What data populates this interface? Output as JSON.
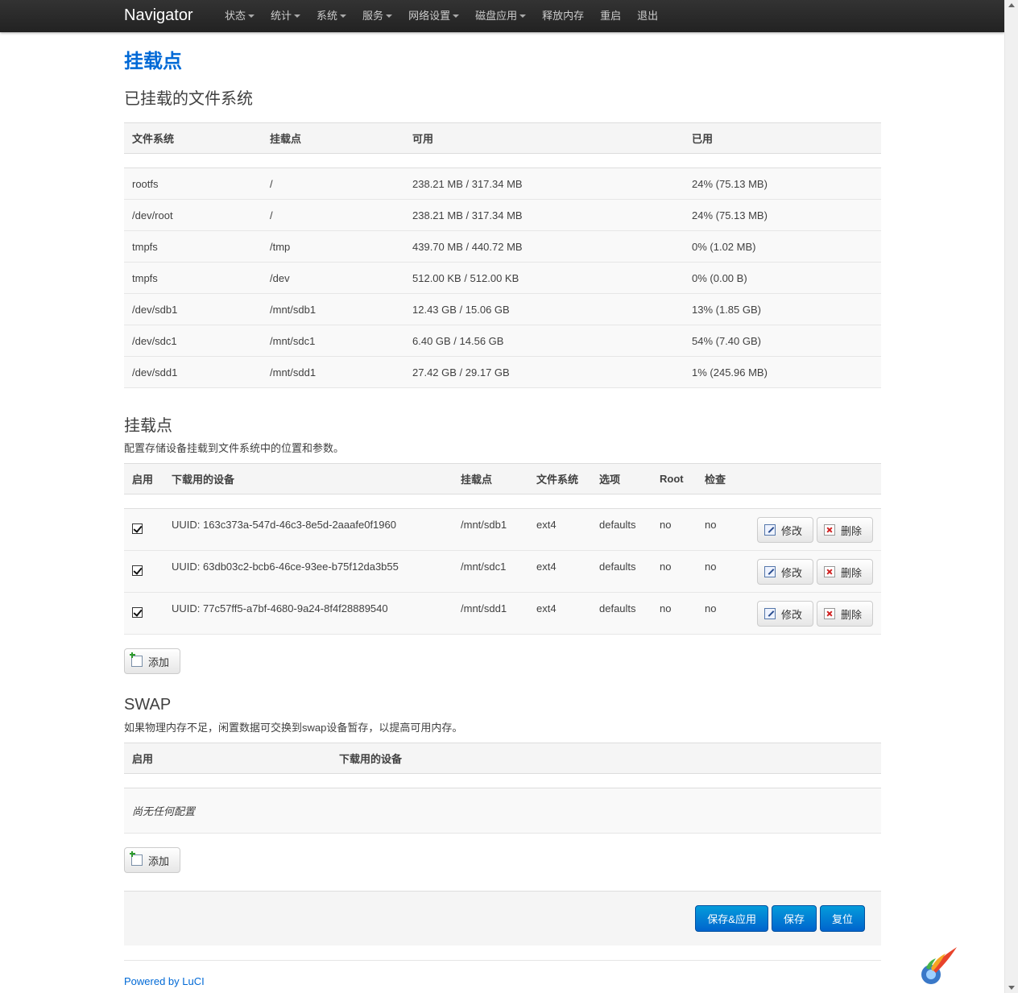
{
  "navbar": {
    "brand": "Navigator",
    "items": [
      {
        "label": "状态",
        "dropdown": true
      },
      {
        "label": "统计",
        "dropdown": true
      },
      {
        "label": "系统",
        "dropdown": true
      },
      {
        "label": "服务",
        "dropdown": true
      },
      {
        "label": "网络设置",
        "dropdown": true
      },
      {
        "label": "磁盘应用",
        "dropdown": true
      },
      {
        "label": "释放内存",
        "dropdown": false
      },
      {
        "label": "重启",
        "dropdown": false
      },
      {
        "label": "退出",
        "dropdown": false
      }
    ]
  },
  "page": {
    "title": "挂载点"
  },
  "mounted": {
    "title": "已挂载的文件系统",
    "headers": [
      "文件系统",
      "挂载点",
      "可用",
      "已用"
    ],
    "rows": [
      [
        "rootfs",
        "/",
        "238.21 MB / 317.34 MB",
        "24% (75.13 MB)"
      ],
      [
        "/dev/root",
        "/",
        "238.21 MB / 317.34 MB",
        "24% (75.13 MB)"
      ],
      [
        "tmpfs",
        "/tmp",
        "439.70 MB / 440.72 MB",
        "0% (1.02 MB)"
      ],
      [
        "tmpfs",
        "/dev",
        "512.00 KB / 512.00 KB",
        "0% (0.00 B)"
      ],
      [
        "/dev/sdb1",
        "/mnt/sdb1",
        "12.43 GB / 15.06 GB",
        "13% (1.85 GB)"
      ],
      [
        "/dev/sdc1",
        "/mnt/sdc1",
        "6.40 GB / 14.56 GB",
        "54% (7.40 GB)"
      ],
      [
        "/dev/sdd1",
        "/mnt/sdd1",
        "27.42 GB / 29.17 GB",
        "1% (245.96 MB)"
      ]
    ]
  },
  "mountpoints": {
    "title": "挂载点",
    "description": "配置存储设备挂载到文件系统中的位置和参数。",
    "headers": [
      "启用",
      "下载用的设备",
      "挂载点",
      "文件系统",
      "选项",
      "Root",
      "检查"
    ],
    "edit_label": "修改",
    "delete_label": "删除",
    "rows": [
      {
        "enabled": true,
        "device": "UUID: 163c373a-547d-46c3-8e5d-2aaafe0f1960",
        "mount": "/mnt/sdb1",
        "fs": "ext4",
        "options": "defaults",
        "root": "no",
        "check": "no"
      },
      {
        "enabled": true,
        "device": "UUID: 63db03c2-bcb6-46ce-93ee-b75f12da3b55",
        "mount": "/mnt/sdc1",
        "fs": "ext4",
        "options": "defaults",
        "root": "no",
        "check": "no"
      },
      {
        "enabled": true,
        "device": "UUID: 77c57ff5-a7bf-4680-9a24-8f4f28889540",
        "mount": "/mnt/sdd1",
        "fs": "ext4",
        "options": "defaults",
        "root": "no",
        "check": "no"
      }
    ],
    "add_label": "添加"
  },
  "swap": {
    "title": "SWAP",
    "description": "如果物理内存不足，闲置数据可交换到swap设备暂存，以提高可用内存。",
    "headers": [
      "启用",
      "下载用的设备"
    ],
    "empty": "尚无任何配置",
    "add_label": "添加"
  },
  "actions": {
    "save_apply": "保存&应用",
    "save": "保存",
    "reset": "复位"
  },
  "footer": {
    "powered": "Powered by LuCI"
  },
  "colors": {
    "accent": "#0069d6",
    "navbar": "#222222",
    "primary_button": "#0064cd"
  }
}
